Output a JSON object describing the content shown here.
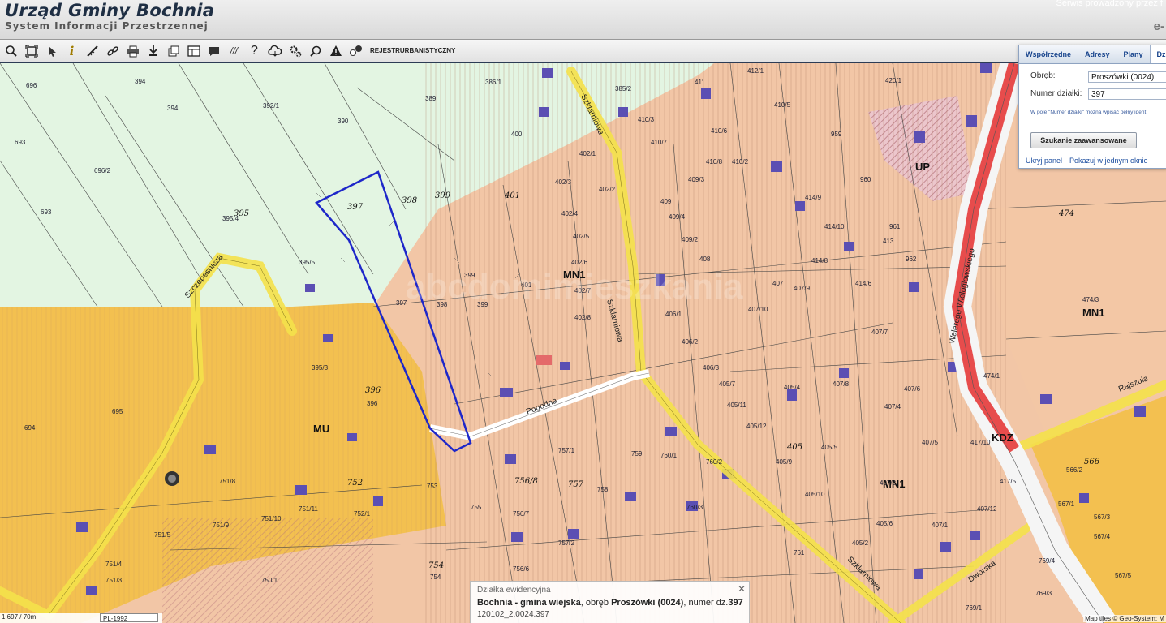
{
  "header": {
    "title": "Urząd Gminy Bochnia",
    "subtitle": "System Informacji Przestrzennej",
    "service_text": "Serwis prowadzony przez f",
    "logo_text": "e-"
  },
  "toolbar": {
    "tools": [
      "zoom-in",
      "zoom-extent",
      "select",
      "info",
      "measure-distance",
      "link",
      "print",
      "download",
      "layers",
      "layout",
      "comment",
      "hatch",
      "help",
      "cloud",
      "settings",
      "search",
      "warning",
      "chat"
    ],
    "info_glyph": "i",
    "help_glyph": "?",
    "hatch_glyph": "///",
    "rejestr_line1": "REJESTR",
    "rejestr_line2": "URBANISTYCZNY"
  },
  "panel": {
    "tabs": [
      "Współrzędne",
      "Adresy",
      "Plany",
      "Dzi"
    ],
    "active_tab": "Dzi",
    "obreb_label": "Obręb:",
    "obreb_value": "Proszówki (0024)",
    "numer_label": "Numer działki:",
    "numer_value": "397",
    "hint": "W pole \"Numer działki\" można wpisać pełny ident",
    "search_button": "Szukanie zaawansowane",
    "hide_link": "Ukryj panel",
    "show_link": "Pokazuj w jednym oknie"
  },
  "info": {
    "heading": "Działka ewidencyjna",
    "line_bold1": "Bochnia - gmina wiejska",
    "line_text1": ", obręb ",
    "line_bold2": "Proszówki (0024)",
    "line_text2": ", numer dz.",
    "line_bold3": "397",
    "id": "120102_2.0024.397",
    "close": "✕"
  },
  "scalebar": {
    "scale": "1:697 / 70m",
    "crs": "PL-1992"
  },
  "attribution": "Map tiles © Geo-System; M",
  "map": {
    "zones": [
      "MU",
      "MN1",
      "MN1",
      "MN1",
      "UP",
      "KDZ"
    ],
    "roads": [
      "Szklarniowa",
      "Szklarniowa",
      "Szklarniowa",
      "Pogodna",
      "Rajszula",
      "Dworska",
      "Walerego Wieloglowskiego",
      "Szczepesnicza"
    ],
    "watermark": "abcdomimieszkania",
    "parcels": [
      "696",
      "394",
      "392/1",
      "386/1",
      "389",
      "385/2",
      "411",
      "412/1",
      "420/1",
      "693",
      "394",
      "390",
      "400",
      "410/3",
      "410/5",
      "696/2",
      "395",
      "397",
      "398",
      "399",
      "401",
      "402/1",
      "410/7",
      "410/6",
      "410/8",
      "410/2",
      "409/3",
      "959",
      "960",
      "693",
      "395/4",
      "402/3",
      "402/2",
      "409",
      "409/4",
      "414/9",
      "414/10",
      "413",
      "961",
      "395/5",
      "399",
      "401",
      "402/4",
      "402/5",
      "409/2",
      "408",
      "402/6",
      "402/7",
      "407",
      "407/9",
      "414/8",
      "414/6",
      "962",
      "397",
      "398",
      "399",
      "402/8",
      "406/1",
      "407/10",
      "407/7",
      "474",
      "474/3",
      "695",
      "395/3",
      "396",
      "396",
      "406/2",
      "406/3",
      "405/7",
      "405/4",
      "407/8",
      "407/4",
      "407/6",
      "474/1",
      "694",
      "405/11",
      "405/12",
      "405",
      "405/5",
      "405/9",
      "407/5",
      "417/10",
      "751/8",
      "757/1",
      "759",
      "760/1",
      "760/2",
      "566/2",
      "566",
      "752",
      "751/11",
      "752/1",
      "753",
      "756/8",
      "757",
      "758",
      "760/3",
      "405/10",
      "405/6",
      "405/2",
      "407/12",
      "407/1",
      "417/5",
      "567/1",
      "567/3",
      "567/4",
      "751/9",
      "751/10",
      "755",
      "756/7",
      "407/3",
      "751/5",
      "757/2",
      "761",
      "567/5",
      "769/4",
      "751/4",
      "751/3",
      "750/1",
      "754",
      "754",
      "756/6",
      "769/3",
      "769/1"
    ]
  }
}
